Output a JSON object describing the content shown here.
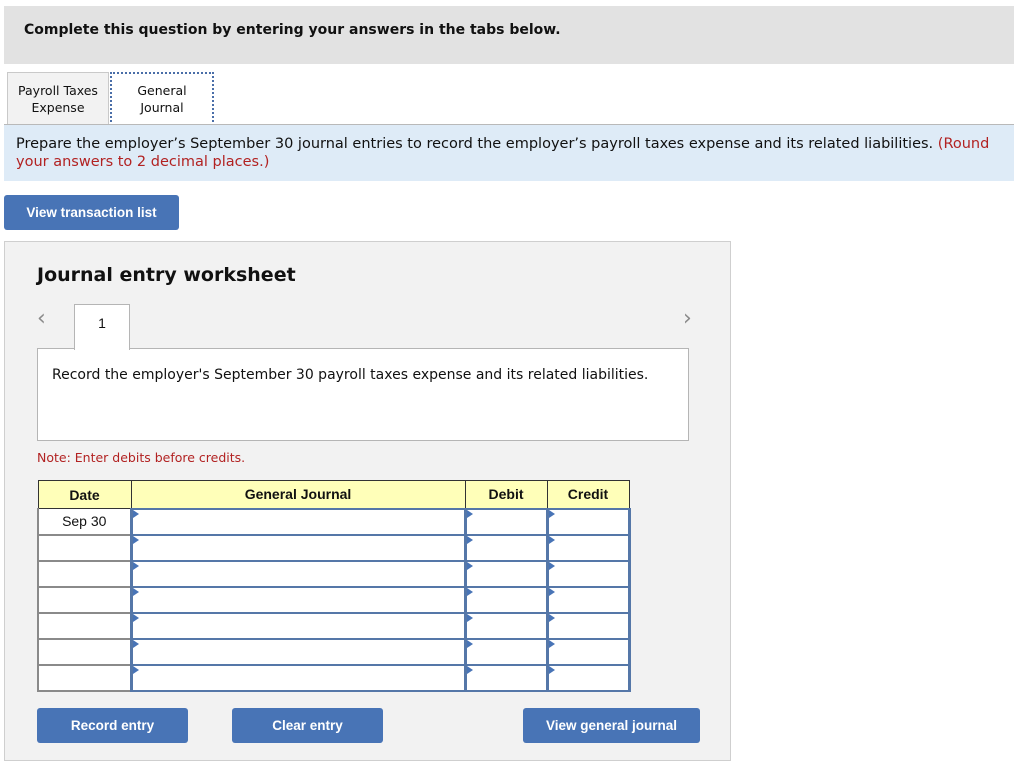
{
  "header": {
    "instruction": "Complete this question by entering your answers in the tabs below."
  },
  "tabs": [
    {
      "label_line1": "Payroll Taxes",
      "label_line2": "Expense",
      "active": false
    },
    {
      "label_line1": "General",
      "label_line2": "Journal",
      "active": true
    }
  ],
  "prompt": {
    "text": "Prepare the employer’s September 30 journal entries to record the employer’s payroll taxes expense and its related liabilities.",
    "note": "(Round your answers to 2 decimal places.)"
  },
  "buttons": {
    "view_transaction_list": "View transaction list",
    "record_entry": "Record entry",
    "clear_entry": "Clear entry",
    "view_general_journal": "View general journal"
  },
  "worksheet": {
    "title": "Journal entry worksheet",
    "prev_icon": "‹",
    "next_icon": "›",
    "entry_number": "1",
    "description": "Record the employer's September 30 payroll taxes expense and its related liabilities.",
    "note": "Note: Enter debits before credits.",
    "table": {
      "headers": [
        "Date",
        "General Journal",
        "Debit",
        "Credit"
      ],
      "rows": [
        {
          "date": "Sep 30",
          "account": "",
          "debit": "",
          "credit": ""
        },
        {
          "date": "",
          "account": "",
          "debit": "",
          "credit": ""
        },
        {
          "date": "",
          "account": "",
          "debit": "",
          "credit": ""
        },
        {
          "date": "",
          "account": "",
          "debit": "",
          "credit": ""
        },
        {
          "date": "",
          "account": "",
          "debit": "",
          "credit": ""
        },
        {
          "date": "",
          "account": "",
          "debit": "",
          "credit": ""
        },
        {
          "date": "",
          "account": "",
          "debit": "",
          "credit": ""
        }
      ]
    }
  }
}
